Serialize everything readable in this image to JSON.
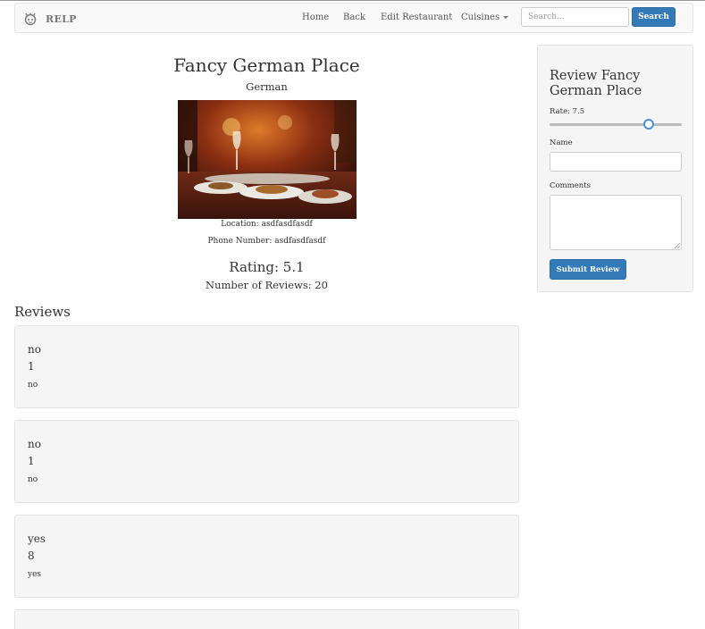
{
  "navbar": {
    "brand": "RELP",
    "links": [
      "Home",
      "Back",
      "Edit Restaurant"
    ],
    "cuisines_label": "Cuisines",
    "search_placeholder": "Search...",
    "search_button": "Search"
  },
  "restaurant": {
    "name": "Fancy German Place",
    "cuisine": "German",
    "location": "Location: asdfasdfasdf",
    "phone": "Phone Number: asdfasdfasdf",
    "rating": "Rating: 5.1",
    "num_reviews": "Number of Reviews: 20"
  },
  "reviews": {
    "heading": "Reviews",
    "items": [
      {
        "name": "no",
        "rating": "1",
        "comment": "no"
      },
      {
        "name": "no",
        "rating": "1",
        "comment": "no"
      },
      {
        "name": "yes",
        "rating": "8",
        "comment": "yes"
      },
      {
        "name": "",
        "rating": "",
        "comment": ""
      }
    ]
  },
  "review_form": {
    "title": "Review Fancy German Place",
    "rate_label": "Rate: 7.5",
    "rate_value": 7.5,
    "rate_min": 0,
    "rate_max": 10,
    "name_label": "Name",
    "comments_label": "Comments",
    "submit_label": "Submit Review"
  },
  "colors": {
    "primary": "#337ab7",
    "panel_bg": "#f5f5f5",
    "navbar_bg": "#f8f8f8"
  }
}
